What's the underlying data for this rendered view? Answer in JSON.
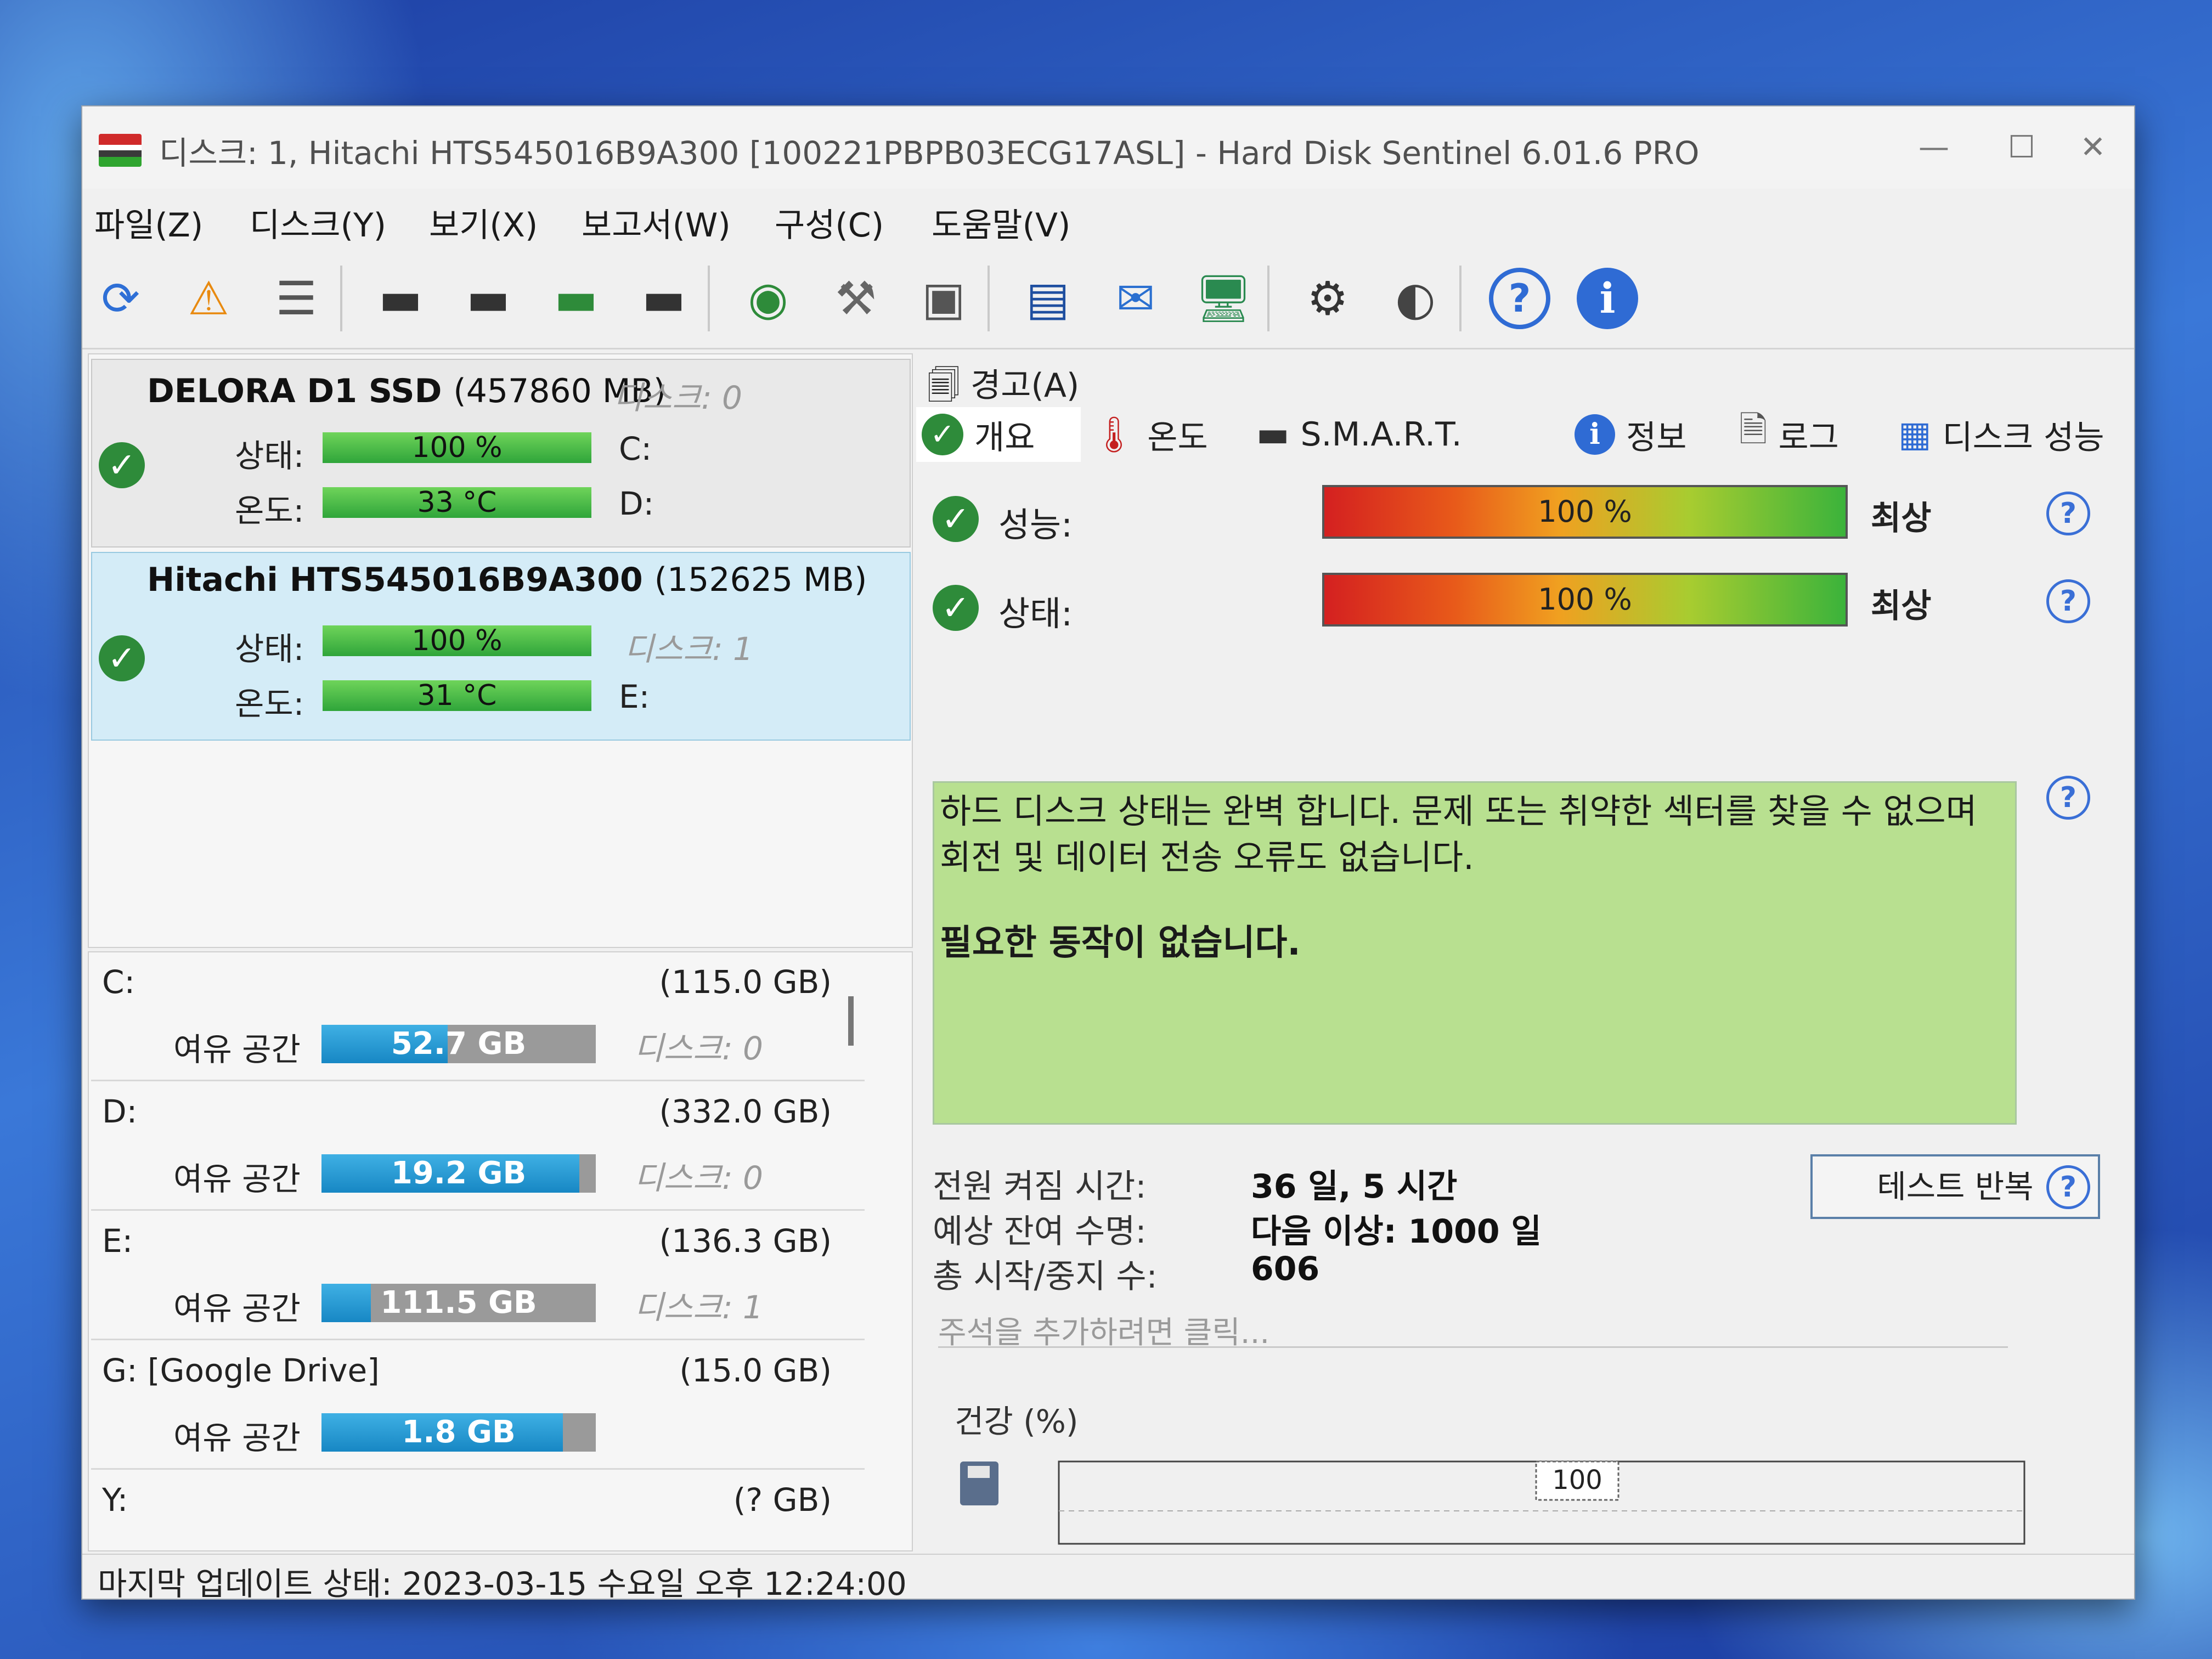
{
  "window": {
    "title": "디스크: 1, Hitachi HTS545016B9A300 [100221PBPB03ECG17ASL]  -  Hard Disk Sentinel 6.01.6 PRO",
    "controls": {
      "minimize": "—",
      "maximize": "☐",
      "close": "✕"
    }
  },
  "menu": [
    "파일(Z)",
    "디스크(Y)",
    "보기(X)",
    "보고서(W)",
    "구성(C)",
    "도움말(V)"
  ],
  "disks": [
    {
      "name": "DELORA D1 SSD",
      "size": "(457860 MB)",
      "disk_label": "디스크: 0",
      "status_label": "상태:",
      "status_value": "100 %",
      "status_pct": 100,
      "temp_label": "온도:",
      "temp_value": "33 °C",
      "drives": [
        "C:",
        "D:"
      ]
    },
    {
      "name": "Hitachi HTS545016B9A300",
      "size": "(152625 MB)",
      "disk_label": "디스크: 1",
      "status_label": "상태:",
      "status_value": "100 %",
      "status_pct": 100,
      "temp_label": "온도:",
      "temp_value": "31 °C",
      "drives": [
        "E:"
      ]
    }
  ],
  "volumes": [
    {
      "name": "C:",
      "size": "(115.0 GB)",
      "free_label": "여유 공간",
      "free": "52.7 GB",
      "free_pct": 46,
      "disk": "디스크: 0"
    },
    {
      "name": "D:",
      "size": "(332.0 GB)",
      "free_label": "여유 공간",
      "free": "19.2 GB",
      "free_pct": 94,
      "disk": "디스크: 0"
    },
    {
      "name": "E:",
      "size": "(136.3 GB)",
      "free_label": "여유 공간",
      "free": "111.5 GB",
      "free_pct": 18,
      "disk": "디스크: 1"
    },
    {
      "name": "G: [Google Drive]",
      "size": "(15.0 GB)",
      "free_label": "여유 공간",
      "free": "1.8 GB",
      "free_pct": 88,
      "disk": ""
    },
    {
      "name": "Y:",
      "size": "(? GB)"
    }
  ],
  "status_bar": "마지막 업데이트 상태: 2023-03-15 수요일 오후 12:24:00",
  "right": {
    "alert_tab": "경고(A)",
    "tabs": [
      {
        "label": "개요",
        "icon": "check-icon"
      },
      {
        "label": "온도",
        "icon": "thermometer-icon"
      },
      {
        "label": "S.M.A.R.T.",
        "icon": "disk-icon"
      },
      {
        "label": "정보",
        "icon": "info-icon"
      },
      {
        "label": "로그",
        "icon": "document-icon"
      },
      {
        "label": "디스크 성능",
        "icon": "chart-icon"
      }
    ],
    "performance_label": "성능:",
    "performance_value": "100 %",
    "performance_pct": 100,
    "performance_rating": "최상",
    "health_label": "상태:",
    "health_value": "100 %",
    "health_pct": 100,
    "health_rating": "최상",
    "message": "하드 디스크 상태는 완벽 합니다. 문제 또는 취약한 섹터를 찾을 수 없으며 회전 및 데이터 전송 오류도 없습니다.",
    "message_action": "필요한 동작이 없습니다.",
    "power_on_label": "전원 켜짐 시간:",
    "power_on_value": "36 일, 5 시간",
    "lifetime_label": "예상 잔여 수명:",
    "lifetime_value": "다음 이상: 1000 일",
    "start_stop_label": "총 시작/중지 수:",
    "start_stop_value": "606",
    "repeat_test_button": "테스트 반복",
    "note_placeholder": "주석을 추가하려면 클릭...",
    "chart_title": "건강 (%)",
    "chart_point_label": "100"
  },
  "colors": {
    "status_green": "#2fa53a",
    "volume_blue": "#1787c4",
    "selected_disk": "#d4ecf7",
    "message_bg": "#b8e090",
    "help_blue": "#3a6fd6"
  }
}
